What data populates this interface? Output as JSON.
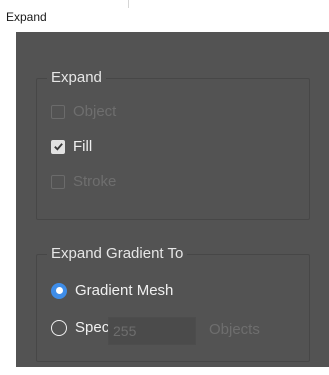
{
  "window": {
    "title": "Expand"
  },
  "expand_group": {
    "legend": "Expand",
    "options": [
      {
        "label": "Object",
        "checked": false,
        "enabled": false
      },
      {
        "label": "Fill",
        "checked": true,
        "enabled": true
      },
      {
        "label": "Stroke",
        "checked": false,
        "enabled": false
      }
    ]
  },
  "gradient_group": {
    "legend": "Expand Gradient To",
    "gradient_mesh_label": "Gradient Mesh",
    "specify_label": "Specify:",
    "specify_value": "255",
    "objects_label": "Objects",
    "selected": "Gradient Mesh"
  },
  "colors": {
    "panel": "#535353",
    "accent": "#3f8de8",
    "disabled_text": "#6e6e6e",
    "text": "#f0f0f0"
  },
  "icons": {
    "checkmark": "checkmark-icon",
    "radio_selected": "radio-selected-icon",
    "radio_unselected": "radio-unselected-icon"
  }
}
